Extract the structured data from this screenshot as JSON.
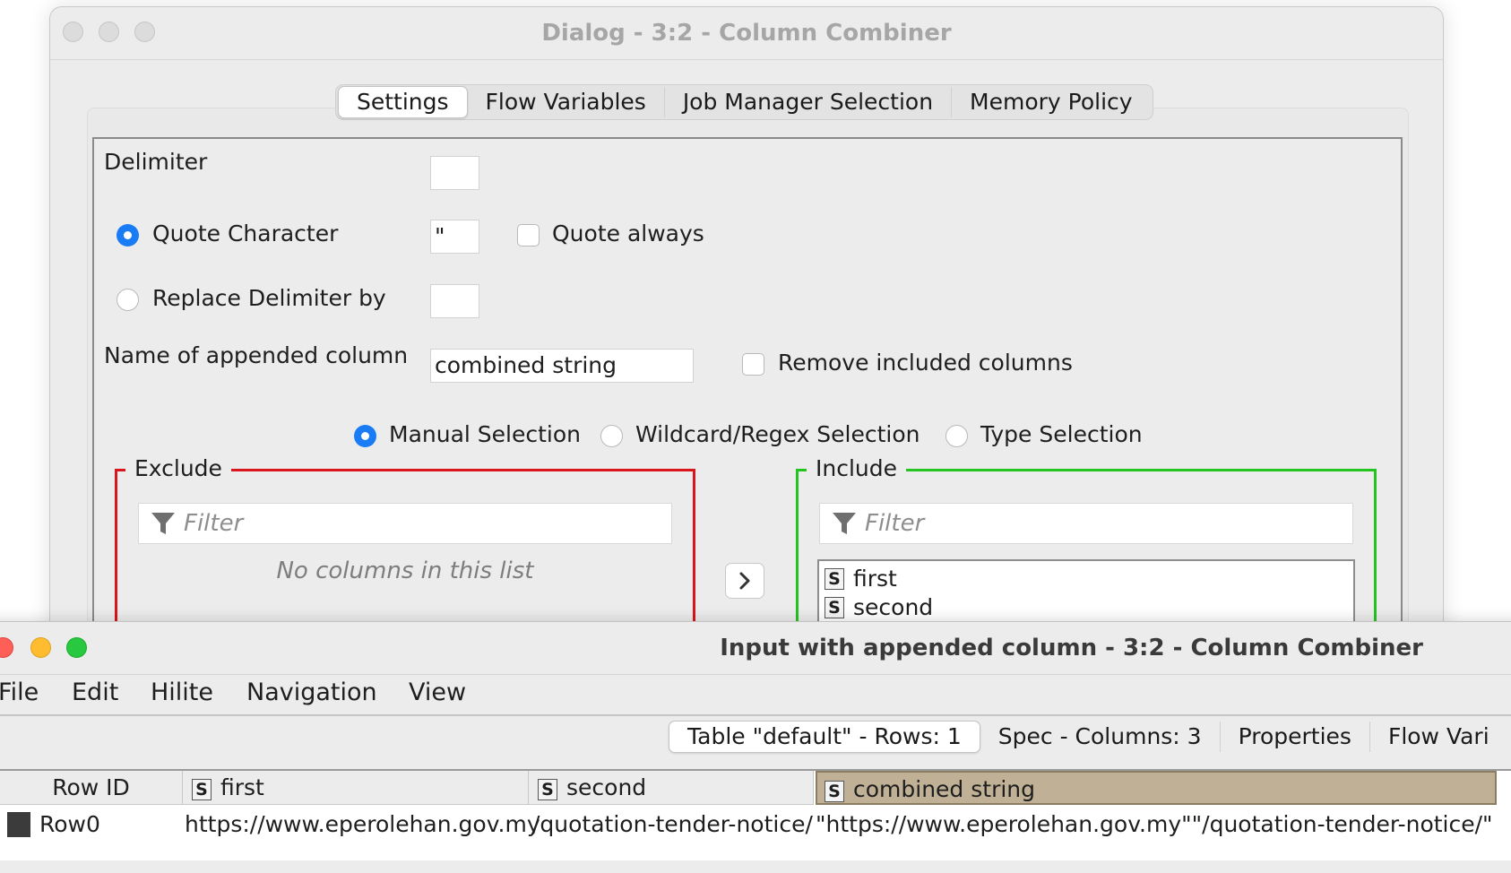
{
  "dialog": {
    "title": "Dialog - 3:2 - Column Combiner",
    "tabs": [
      {
        "label": "Settings",
        "active": true
      },
      {
        "label": "Flow Variables"
      },
      {
        "label": "Job Manager Selection"
      },
      {
        "label": "Memory Policy"
      }
    ],
    "settings": {
      "delimiter_label": "Delimiter",
      "delimiter_value": "",
      "quote_char_label": "Quote Character",
      "quote_char_value": "\"",
      "quote_char_selected": true,
      "quote_always_label": "Quote always",
      "quote_always_checked": false,
      "replace_delim_label": "Replace Delimiter by",
      "replace_delim_value": "",
      "appended_col_label": "Name of appended column",
      "appended_col_value": "combined string",
      "remove_included_label": "Remove included columns",
      "remove_included_checked": false,
      "selection_modes": [
        "Manual Selection",
        "Wildcard/Regex Selection",
        "Type Selection"
      ],
      "selected_mode": "Manual Selection"
    },
    "exclude": {
      "label": "Exclude",
      "filter_placeholder": "Filter",
      "empty_text": "No columns in this list",
      "color": "#d9161c"
    },
    "include": {
      "label": "Include",
      "filter_placeholder": "Filter",
      "color": "#23c41f",
      "columns": [
        {
          "type": "S",
          "name": "first"
        },
        {
          "type": "S",
          "name": "second"
        }
      ]
    },
    "move_button_icon": "chevron-right-icon"
  },
  "table_window": {
    "title": "Input with appended column - 3:2 - Column Combiner",
    "menu": [
      "File",
      "Edit",
      "Hilite",
      "Navigation",
      "View"
    ],
    "tabs": [
      {
        "label": "Table \"default\" - Rows: 1",
        "active": true
      },
      {
        "label": "Spec - Columns: 3"
      },
      {
        "label": "Properties"
      },
      {
        "label": "Flow Vari"
      }
    ],
    "headers": [
      {
        "label": "Row ID"
      },
      {
        "type": "S",
        "label": "first"
      },
      {
        "type": "S",
        "label": "second"
      },
      {
        "type": "S",
        "label": "combined string",
        "highlight": "#c0b196"
      }
    ],
    "rows": [
      {
        "row_id": "Row0",
        "first": "https://www.eperolehan.gov.my",
        "second": "/quotation-tender-notice/",
        "combined": "\"https://www.eperolehan.gov.my\"\"/quotation-tender-notice/\""
      }
    ]
  }
}
